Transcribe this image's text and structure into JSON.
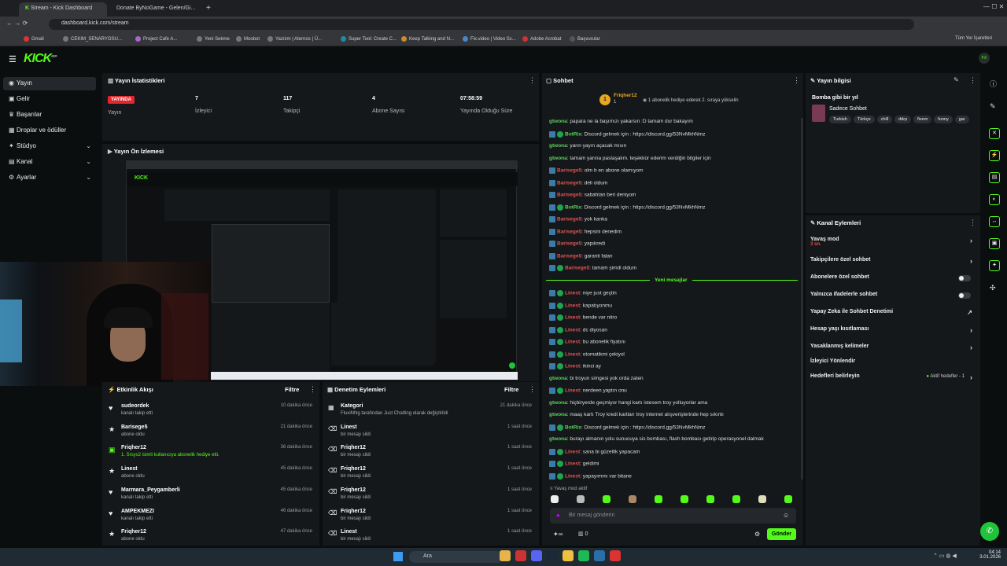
{
  "browser": {
    "tabs": [
      {
        "label": "Stream - Kick Dashboard"
      },
      {
        "label": "Donate ByNoGame - Gelen/Gi..."
      }
    ],
    "url": "dashboard.kick.com/stream",
    "bookmarks": [
      "Gmail",
      "CEKIM_SENARYOSU...",
      "Project Cafe A...",
      "Yeni Sekme",
      "Moobot",
      "Yazılım | Aternos | Ü...",
      "Super Tool: Create C...",
      "Keep Talking and N...",
      "Fix.video | Video Sc...",
      "Adobe Acrobat",
      "Başvurular"
    ],
    "all_bookmarks": "Tüm Yer İşaretleri"
  },
  "header": {
    "logo": "KICK",
    "logo_sup": "BETA"
  },
  "nav": [
    {
      "label": "Yayın",
      "icon": "broadcast-icon"
    },
    {
      "label": "Gelir",
      "icon": "wallet-icon"
    },
    {
      "label": "Başarılar",
      "icon": "trophy-icon"
    },
    {
      "label": "Droplar ve ödüller",
      "icon": "gift-icon"
    },
    {
      "label": "Stüdyo",
      "icon": "studio-icon"
    },
    {
      "label": "Kanal",
      "icon": "channel-icon"
    },
    {
      "label": "Ayarlar",
      "icon": "gear-icon"
    }
  ],
  "stats": {
    "title": "Yayın İstatistikleri",
    "live_badge": "YAYINDA",
    "items": [
      {
        "value": "7",
        "label": "İzleyici"
      },
      {
        "value": "117",
        "label": "Takipçi"
      },
      {
        "value": "4",
        "label": "Abone Sayısı"
      },
      {
        "value": "07:58:59",
        "label": "Yayında Olduğu Süre"
      }
    ],
    "first_label": "Yayın"
  },
  "preview": {
    "title": "Yayın Ön İzlemesi"
  },
  "activity": {
    "title": "Etkinlik Akışı",
    "filter": "Filtre",
    "rows": [
      {
        "name": "sudeordek",
        "sub": "kanalı takip etti",
        "time": "10 dakika önce",
        "icon": "heart-icon"
      },
      {
        "name": "Barisege5",
        "sub": "abone oldu",
        "time": "21 dakika önce",
        "icon": "star-icon"
      },
      {
        "name": "Friqher12",
        "sub": "1. Srsys2 isimli kullanıcıya abonelik hediye etti.",
        "time": "36 dakika önce",
        "icon": "gift-icon"
      },
      {
        "name": "Linest",
        "sub": "abone oldu",
        "time": "45 dakika önce",
        "icon": "star-icon"
      },
      {
        "name": "Marmara_Peygamberli",
        "sub": "kanalı takip etti",
        "time": "45 dakika önce",
        "icon": "heart-icon"
      },
      {
        "name": "AMPEKMEZI",
        "sub": "kanalı takip etti",
        "time": "46 dakika önce",
        "icon": "heart-icon"
      },
      {
        "name": "Friqher12",
        "sub": "abone oldu",
        "time": "47 dakika önce",
        "icon": "star-icon"
      }
    ]
  },
  "moderation": {
    "title": "Denetim Eylemleri",
    "filter": "Filtre",
    "rows": [
      {
        "name": "Kategori",
        "sub": "FluxiNNg tarafından Just Chatting olarak değiştirildi",
        "time": "21 dakika önce"
      },
      {
        "name": "Linest",
        "sub": "bir mesajı sildi",
        "time": "1 saat önce"
      },
      {
        "name": "Friqher12",
        "sub": "bir mesajı sildi",
        "time": "1 saat önce"
      },
      {
        "name": "Friqher12",
        "sub": "bir mesajı sildi",
        "time": "1 saat önce"
      },
      {
        "name": "Friqher12",
        "sub": "bir mesajı sildi",
        "time": "1 saat önce"
      },
      {
        "name": "Friqher12",
        "sub": "bir mesajı sildi",
        "time": "1 saat önce"
      },
      {
        "name": "Linest",
        "sub": "bir mesajı sildi",
        "time": "1 saat önce"
      }
    ]
  },
  "chat": {
    "title": "Sohbet",
    "pinned_user": "Friqher12",
    "pinned_count": "1",
    "pinned_text": "1 abonelik hediye ederek 2. sıraya yükselin",
    "lines": [
      {
        "user": "gtwona",
        "text": "papara ne la başımızı yakarsın :D tamam dur bakayım",
        "color": "#5bd15b",
        "kind": "plain"
      },
      {
        "user": "BotRix",
        "text": "Discord gelmek için : https://discord.gg/53NvMkhNmz",
        "color": "#5bd15b",
        "kind": "bot"
      },
      {
        "user": "gtwona",
        "text": "yarın yayın açacak mısın",
        "color": "#5bd15b",
        "kind": "plain"
      },
      {
        "user": "gtwona",
        "text": "tamam yarına paslaşalım. teşekkür ederim verdiğin bilgiler için",
        "color": "#5bd15b",
        "kind": "plain"
      },
      {
        "user": "Barisege5",
        "text": "olm b en abone olamıyom",
        "color": "#e05252",
        "kind": "sub"
      },
      {
        "user": "Barisege5",
        "text": "deli oldum",
        "color": "#e05252",
        "kind": "sub"
      },
      {
        "user": "Barisege5",
        "text": "sabahtan beri deniyom",
        "color": "#e05252",
        "kind": "sub"
      },
      {
        "user": "BotRix",
        "text": "Discord gelmek için : https://discord.gg/53NvMkhNmz",
        "color": "#5bd15b",
        "kind": "bot"
      },
      {
        "user": "Barisege5",
        "text": "yok kanka",
        "color": "#e05252",
        "kind": "sub"
      },
      {
        "user": "Barisege5",
        "text": "hepsini denedim",
        "color": "#e05252",
        "kind": "sub"
      },
      {
        "user": "Barisege5",
        "text": "yapıkredi",
        "color": "#e05252",
        "kind": "sub"
      },
      {
        "user": "Barisege5",
        "text": "garanti falan",
        "color": "#e05252",
        "kind": "sub"
      },
      {
        "user": "Barisege5",
        "text": "tamam şimdi oldum",
        "color": "#e05252",
        "kind": "sub2"
      }
    ],
    "new_messages": "Yeni mesajlar",
    "lines2": [
      {
        "user": "Linest",
        "text": "niye just geçtin",
        "color": "#e05252",
        "kind": "sub2"
      },
      {
        "user": "Linest",
        "text": "kapatıyonmu",
        "color": "#e05252",
        "kind": "sub2"
      },
      {
        "user": "Linest",
        "text": "bende var nitro",
        "color": "#e05252",
        "kind": "sub2"
      },
      {
        "user": "Linest",
        "text": "dc diyosan",
        "color": "#e05252",
        "kind": "sub2"
      },
      {
        "user": "Linest",
        "text": "bu abonelik fiyatını",
        "color": "#e05252",
        "kind": "sub2"
      },
      {
        "user": "Linest",
        "text": "otomatikmi çekiyol",
        "color": "#e05252",
        "kind": "sub2"
      },
      {
        "user": "Linest",
        "text": "ikinci ay",
        "color": "#e05252",
        "kind": "sub2"
      },
      {
        "user": "gtwona",
        "text": "bi troyun simgesi yok orda zaten",
        "color": "#5bd15b",
        "kind": "plain"
      },
      {
        "user": "Linest",
        "text": "nerdeen yaptın onu",
        "color": "#e05252",
        "kind": "sub2"
      },
      {
        "user": "gtwona",
        "text": "hiçbiryerde geçmiyor hangi kartı istesem troy yolluyorlar ama",
        "color": "#5bd15b",
        "kind": "plain"
      },
      {
        "user": "gtwona",
        "text": "maaş kartı Troy kredi kartları troy internet alışverişlerinde hep sıkıntı",
        "color": "#5bd15b",
        "kind": "plain"
      },
      {
        "user": "BotRix",
        "text": "Discord gelmek için : https://discord.gg/53NvMkhNmz",
        "color": "#5bd15b",
        "kind": "bot"
      },
      {
        "user": "gtwona",
        "text": "burayı almanın yolu sunucuya sis bombası, flash bombası getirip operasyonel dalmak",
        "color": "#5bd15b",
        "kind": "plain"
      },
      {
        "user": "Linest",
        "text": "sana bi güzellik yapacam",
        "color": "#e05252",
        "kind": "sub2"
      },
      {
        "user": "Linest",
        "text": "geldimi",
        "color": "#e05252",
        "kind": "sub2"
      },
      {
        "user": "Linest",
        "text": "yapayımmı var bitane",
        "color": "#e05252",
        "kind": "sub2"
      }
    ],
    "slow_mode": "Yavaş mod aktif",
    "input_placeholder": "Bir mesaj gönderin",
    "send": "Gönder",
    "points": "0"
  },
  "info": {
    "title": "Yayın bilgisi",
    "stream_title": "Bomba gibi bir yıl",
    "category": "Sadece Sohbet",
    "tags": [
      "Turkish",
      "Türkçe",
      "chill",
      "ddrp",
      "fivem",
      "funny",
      "gar"
    ]
  },
  "channel_actions": {
    "title": "Kanal Eylemleri",
    "items": [
      {
        "label": "Yavaş mod",
        "sub": "3 sn.",
        "control": "chevron"
      },
      {
        "label": "Takipçilere özel sohbet",
        "control": "chevron"
      },
      {
        "label": "Abonelere özel sohbet",
        "control": "toggle"
      },
      {
        "label": "Yalnızca ifadelerle sohbet",
        "control": "toggle"
      },
      {
        "label": "Yapay Zeka ile Sohbet Denetimi",
        "control": "external"
      },
      {
        "label": "Hesap yaşı kısıtlaması",
        "control": "chevron"
      },
      {
        "label": "Yasaklanmış kelimeler",
        "control": "chevron"
      },
      {
        "label": "İzleyici Yönlendir",
        "control": "none"
      },
      {
        "label": "Hedefleri belirleyin",
        "control": "chevron",
        "extra": "Aktif hedefler - 1"
      }
    ]
  },
  "taskbar": {
    "search": "Ara",
    "time": "04:14",
    "date": "3.01.2026"
  },
  "colors": {
    "accent": "#53fc18",
    "live": "#e0272d",
    "panel": "#15181b"
  }
}
